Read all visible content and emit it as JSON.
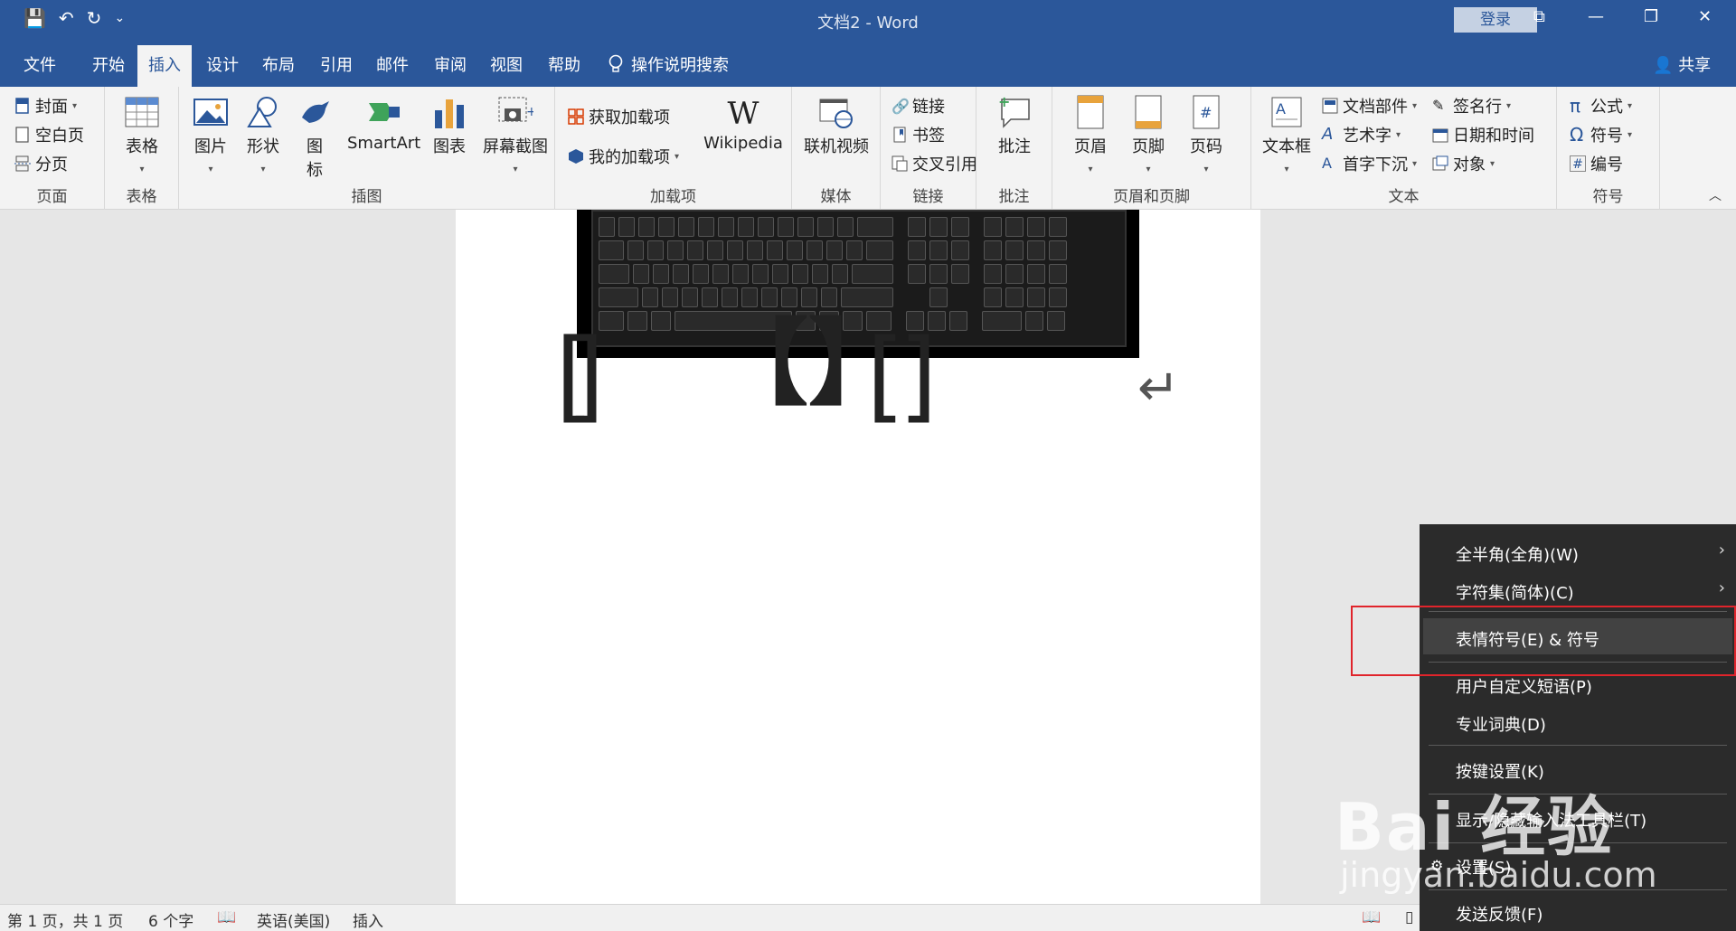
{
  "titlebar": {
    "title": "文档2  -  Word",
    "login": "登录",
    "qat_save": "💾",
    "qat_undo": "↶",
    "qat_redo": "↻",
    "qat_more": "⌄",
    "win_restore_ribbon": "⧉",
    "win_minimize": "—",
    "win_maximize": "❐",
    "win_close": "✕"
  },
  "tabs": {
    "file": "文件",
    "home": "开始",
    "insert": "插入",
    "design": "设计",
    "layout": "布局",
    "references": "引用",
    "mailings": "邮件",
    "review": "审阅",
    "view": "视图",
    "help": "帮助",
    "search": "操作说明搜索",
    "share": "共享"
  },
  "ribbon": {
    "pages": {
      "label": "页面",
      "cover": "封面",
      "blank": "空白页",
      "break": "分页"
    },
    "tables": {
      "label": "表格",
      "table": "表格"
    },
    "illustrations": {
      "label": "插图",
      "picture": "图片",
      "shapes": "形状",
      "icons_line1": "图",
      "icons_line2": "标",
      "smartart": "SmartArt",
      "chart": "图表",
      "screenshot": "屏幕截图"
    },
    "addins": {
      "label": "加载项",
      "get": "获取加载项",
      "my": "我的加载项",
      "wikipedia": "Wikipedia",
      "wiki_glyph": "W"
    },
    "media": {
      "label": "媒体",
      "video": "联机视频"
    },
    "links": {
      "label": "链接",
      "link": "链接",
      "bookmark": "书签",
      "crossref": "交叉引用"
    },
    "comments": {
      "label": "批注",
      "comment": "批注"
    },
    "headerfooter": {
      "label": "页眉和页脚",
      "header": "页眉",
      "footer": "页脚",
      "pagenum": "页码"
    },
    "text": {
      "label": "文本",
      "textbox": "文本框",
      "quickparts": "文档部件",
      "wordart": "艺术字",
      "dropcap": "首字下沉",
      "signature": "签名行",
      "datetime": "日期和时间",
      "object": "对象"
    },
    "symbols": {
      "label": "符号",
      "equation": "公式",
      "symbol": "符号",
      "number": "编号",
      "pi": "π",
      "omega": "Ω",
      "hash": "#"
    }
  },
  "document": {
    "brackets": {
      "b1_open": "[",
      "b1_close": "]",
      "b2": "【】",
      "b3_open": "[",
      "b3_close": "]",
      "return_mark": "↵"
    }
  },
  "statusbar": {
    "page": "第 1 页，共 1 页",
    "words": "6 个字",
    "language": "英语(美国)",
    "mode": "插入"
  },
  "context_menu": {
    "items": [
      {
        "label": "全半角(全角)(W)",
        "arrow": "›"
      },
      {
        "label": "字符集(简体)(C)",
        "arrow": "›"
      },
      {
        "label": "表情符号(E) & 符号"
      },
      {
        "label": "用户自定义短语(P)"
      },
      {
        "label": "专业词典(D)"
      },
      {
        "label": "按键设置(K)"
      },
      {
        "label": "显示/隐藏输入法工具栏(T)"
      },
      {
        "label": "设置(S)"
      },
      {
        "label": "发送反馈(F)"
      }
    ]
  },
  "watermark": {
    "big": "Bai 经验",
    "small": "jingyan.baidu.com"
  },
  "colors": {
    "accent": "#2b579a",
    "menu_bg": "#2b2b2b",
    "highlight": "#e0242b"
  }
}
